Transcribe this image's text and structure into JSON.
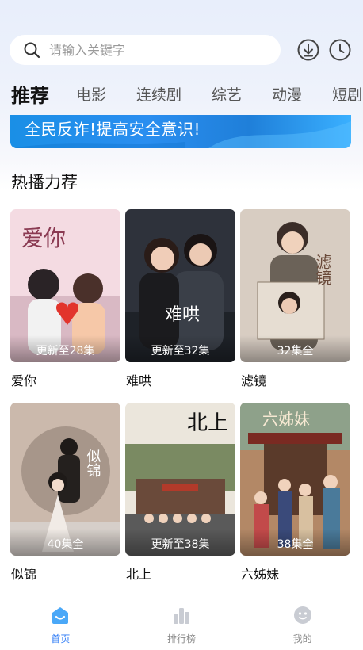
{
  "search": {
    "placeholder": "请输入关键字"
  },
  "header_icons": [
    "download-icon",
    "history-clock-icon"
  ],
  "tabs": [
    {
      "label": "推荐",
      "active": true
    },
    {
      "label": "电影"
    },
    {
      "label": "连续剧"
    },
    {
      "label": "综艺"
    },
    {
      "label": "动漫"
    },
    {
      "label": "短剧"
    }
  ],
  "banner": {
    "text": "全民反诈!提高安全意识!"
  },
  "section": {
    "title": "热播力荐"
  },
  "shows": [
    {
      "title": "爱你",
      "badge": "更新至28集",
      "poster_text": "爱你",
      "accent": "#f0d0d8"
    },
    {
      "title": "难哄",
      "badge": "更新至32集",
      "poster_text": "难哄",
      "accent": "#3a3f4a"
    },
    {
      "title": "滤镜",
      "badge": "32集全",
      "poster_text": "滤镜",
      "accent": "#c9b9a8"
    },
    {
      "title": "似锦",
      "badge": "40集全",
      "poster_text": "似锦",
      "accent": "#6b5a52"
    },
    {
      "title": "北上",
      "badge": "更新至38集",
      "poster_text": "北上",
      "accent": "#5a6a4a"
    },
    {
      "title": "六姊妹",
      "badge": "38集全",
      "poster_text": "六姊妹",
      "accent": "#a87a5a"
    }
  ],
  "bottom_nav": [
    {
      "label": "首页",
      "icon": "home-icon",
      "active": true
    },
    {
      "label": "排行榜",
      "icon": "ranking-icon"
    },
    {
      "label": "我的",
      "icon": "profile-icon"
    }
  ],
  "colors": {
    "accent": "#2f7cf6",
    "banner": "#1f8ae8"
  }
}
